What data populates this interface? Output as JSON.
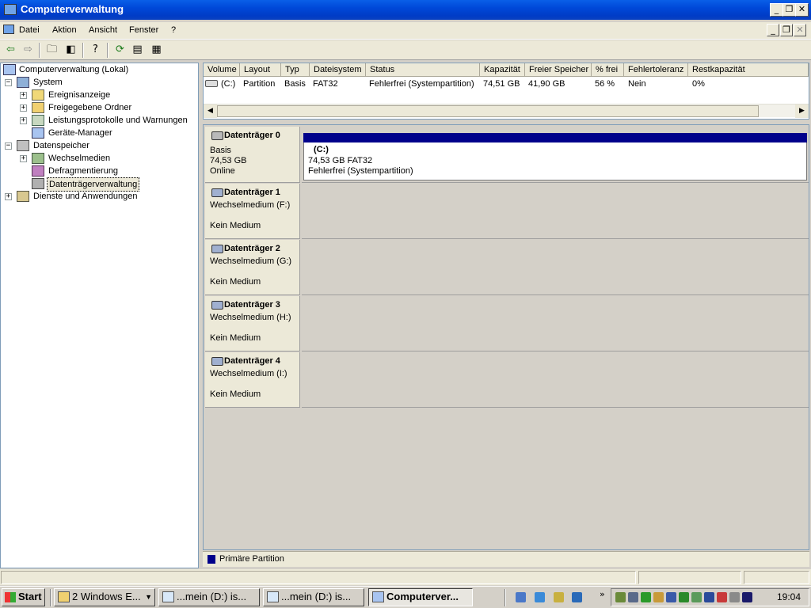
{
  "window": {
    "title": "Computerverwaltung"
  },
  "menu": [
    "Datei",
    "Aktion",
    "Ansicht",
    "Fenster",
    "?"
  ],
  "tree": {
    "root": "Computerverwaltung (Lokal)",
    "system": "System",
    "system_items": [
      "Ereignisanzeige",
      "Freigegebene Ordner",
      "Leistungsprotokolle und Warnungen",
      "Geräte-Manager"
    ],
    "storage": "Datenspeicher",
    "storage_items": [
      "Wechselmedien",
      "Defragmentierung",
      "Datenträgerverwaltung"
    ],
    "services": "Dienste und Anwendungen"
  },
  "volumes": {
    "columns": [
      "Volume",
      "Layout",
      "Typ",
      "Dateisystem",
      "Status",
      "Kapazität",
      "Freier Speicher",
      "% frei",
      "Fehlertoleranz",
      "Restkapazität"
    ],
    "rows": [
      [
        "(C:)",
        "Partition",
        "Basis",
        "FAT32",
        "Fehlerfrei (Systempartition)",
        "74,51 GB",
        "41,90 GB",
        "56 %",
        "Nein",
        "0%"
      ]
    ]
  },
  "disks": [
    {
      "name": "Datenträger 0",
      "line1": "Basis",
      "line2": "74,53 GB",
      "line3": "Online",
      "partition": {
        "label": "(C:)",
        "size": "74,53 GB FAT32",
        "status": "Fehlerfrei (Systempartition)"
      }
    },
    {
      "name": "Datenträger 1",
      "line1": "Wechselmedium (F:)",
      "line2": "",
      "line3": "Kein Medium"
    },
    {
      "name": "Datenträger 2",
      "line1": "Wechselmedium (G:)",
      "line2": "",
      "line3": "Kein Medium"
    },
    {
      "name": "Datenträger 3",
      "line1": "Wechselmedium (H:)",
      "line2": "",
      "line3": "Kein Medium"
    },
    {
      "name": "Datenträger 4",
      "line1": "Wechselmedium (I:)",
      "line2": "",
      "line3": "Kein Medium"
    }
  ],
  "legend": {
    "label": "Primäre Partition",
    "color": "#00008b"
  },
  "taskbar": {
    "start": "Start",
    "buttons": [
      "2 Windows E...",
      "...mein (D:) is...",
      "...mein (D:) is...",
      "Computerver..."
    ],
    "clock": "19:04"
  },
  "colors": {
    "titlebar": "#0048d8",
    "partition_bar": "#00008b"
  }
}
